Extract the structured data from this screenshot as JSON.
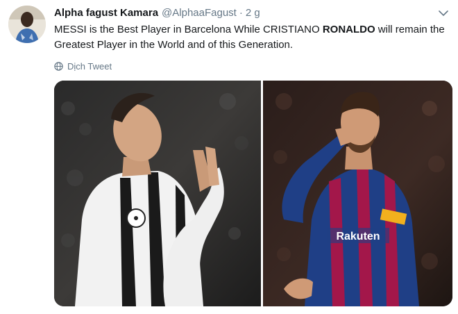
{
  "tweet": {
    "author_name": "Alpha fagust Kamara",
    "author_handle": "@AlphaaFagust",
    "separator": "·",
    "time": "2 g",
    "text_part1": "MESSI is the Best Player in Barcelona While CRISTIANO ",
    "text_bold": "RONALDO",
    "text_part2": " will remain the Greatest Player in the World and of this Generation.",
    "translate_label": "Dịch Tweet"
  },
  "media": {
    "left_photo": "ronaldo-juventus-photo",
    "right_photo": "messi-barcelona-photo",
    "right_jersey_text": "Rakuten"
  },
  "colors": {
    "text_primary": "#14171a",
    "text_secondary": "#657786",
    "background": "#ffffff"
  },
  "icons": {
    "caret": "chevron-down-icon",
    "translate": "globe-icon"
  }
}
